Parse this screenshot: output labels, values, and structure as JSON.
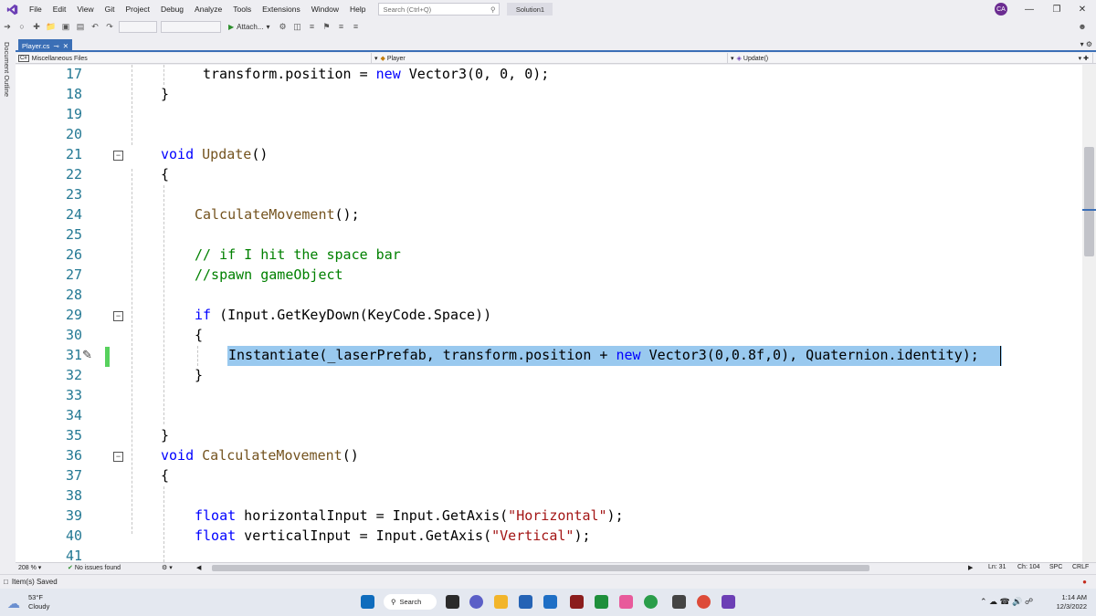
{
  "menu": {
    "items": [
      "File",
      "Edit",
      "View",
      "Git",
      "Project",
      "Debug",
      "Analyze",
      "Tools",
      "Extensions",
      "Window",
      "Help"
    ],
    "search_placeholder": "Search (Ctrl+Q)",
    "solution_name": "Solution1",
    "avatar_initials": "CA"
  },
  "toolbar": {
    "attach_label": "Attach..."
  },
  "left_rail": {
    "label": "Document Outline"
  },
  "tabs": [
    {
      "label": "Player.cs",
      "active": true
    }
  ],
  "navbar": {
    "project": "Miscellaneous Files",
    "type": "Player",
    "member": "Update()"
  },
  "editor": {
    "lines": [
      {
        "num": "17"
      },
      {
        "num": "18"
      },
      {
        "num": "19"
      },
      {
        "num": "20"
      },
      {
        "num": "21"
      },
      {
        "num": "22"
      },
      {
        "num": "23"
      },
      {
        "num": "24"
      },
      {
        "num": "25"
      },
      {
        "num": "26"
      },
      {
        "num": "27"
      },
      {
        "num": "28"
      },
      {
        "num": "29"
      },
      {
        "num": "30"
      },
      {
        "num": "31"
      },
      {
        "num": "32"
      },
      {
        "num": "33"
      },
      {
        "num": "34"
      },
      {
        "num": "35"
      },
      {
        "num": "36"
      },
      {
        "num": "37"
      },
      {
        "num": "38"
      },
      {
        "num": "39"
      },
      {
        "num": "40"
      },
      {
        "num": "41"
      }
    ],
    "code": {
      "l17_a": "transform.position = ",
      "l17_kw": "new",
      "l17_b": " Vector3(0, 0, 0);",
      "l18": "}",
      "l21_kw": "void",
      "l21_mt": "Update",
      "l21_b": "()",
      "l22": "{",
      "l24_mt": "CalculateMovement",
      "l24_b": "();",
      "l26": "// if I hit the space bar",
      "l27": "//spawn gameObject",
      "l29_kw": "if",
      "l29_b": " (Input.GetKeyDown(KeyCode.Space))",
      "l30": "{",
      "l31_a": "Instantiate(_laserPrefab, transform.position + ",
      "l31_kw": "new",
      "l31_b": " Vector3(0,0.8f,0), Quaternion.identity);",
      "l32": "}",
      "l35": "}",
      "l36_kw": "void",
      "l36_mt": "CalculateMovement",
      "l36_b": "()",
      "l37": "{",
      "l39_kw": "float",
      "l39_a": " horizontalInput = Input.GetAxis(",
      "l39_st": "\"Horizontal\"",
      "l39_b": ");",
      "l40_kw": "float",
      "l40_a": " verticalInput = Input.GetAxis(",
      "l40_st": "\"Vertical\"",
      "l40_b": ");"
    },
    "selected_line": "31"
  },
  "editor_status": {
    "zoom": "208 %",
    "issues": "No issues found",
    "line": "Ln: 31",
    "char": "Ch: 104",
    "whitespace": "SPC",
    "line_ending": "CRLF"
  },
  "statusbar": {
    "message": "Item(s) Saved"
  },
  "taskbar": {
    "weather_temp": "53°F",
    "weather_desc": "Cloudy",
    "search_label": "Search",
    "time": "1:14 AM",
    "date": "12/3/2022"
  },
  "colors": {
    "accent": "#3b6fb6",
    "selection": "#99c9ef",
    "keyword": "#0000ff",
    "comment": "#008000",
    "method": "#74531f",
    "string": "#a31515",
    "line_number": "#237893"
  }
}
